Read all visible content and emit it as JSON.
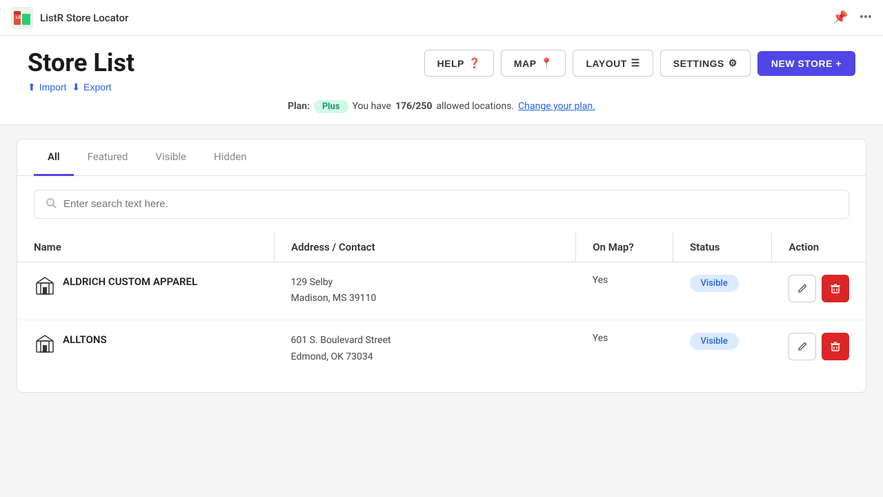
{
  "app": {
    "title": "ListR Store Locator"
  },
  "page": {
    "title": "Store List",
    "import_label": "Import",
    "export_label": "Export"
  },
  "toolbar": {
    "help_label": "HELP",
    "map_label": "MAP",
    "layout_label": "LAYOUT",
    "settings_label": "SETTINGS",
    "new_store_label": "NEW STORE +"
  },
  "plan": {
    "label": "Plan:",
    "badge": "Plus",
    "message_prefix": "You have",
    "count": "176/250",
    "message_suffix": "allowed locations.",
    "link": "Change your plan."
  },
  "tabs": [
    {
      "id": "all",
      "label": "All",
      "active": true
    },
    {
      "id": "featured",
      "label": "Featured",
      "active": false
    },
    {
      "id": "visible",
      "label": "Visible",
      "active": false
    },
    {
      "id": "hidden",
      "label": "Hidden",
      "active": false
    }
  ],
  "search": {
    "placeholder": "Enter search text here."
  },
  "table": {
    "columns": {
      "name": "Name",
      "address": "Address / Contact",
      "onmap": "On Map?",
      "status": "Status",
      "action": "Action"
    },
    "rows": [
      {
        "id": 1,
        "name": "ALDRICH CUSTOM APPAREL",
        "address_line1": "129 Selby",
        "address_line2": "Madison, MS 39110",
        "on_map": "Yes",
        "status": "Visible"
      },
      {
        "id": 2,
        "name": "ALLTONS",
        "address_line1": "601 S. Boulevard Street",
        "address_line2": "Edmond, OK 73034",
        "on_map": "Yes",
        "status": "Visible"
      }
    ]
  }
}
